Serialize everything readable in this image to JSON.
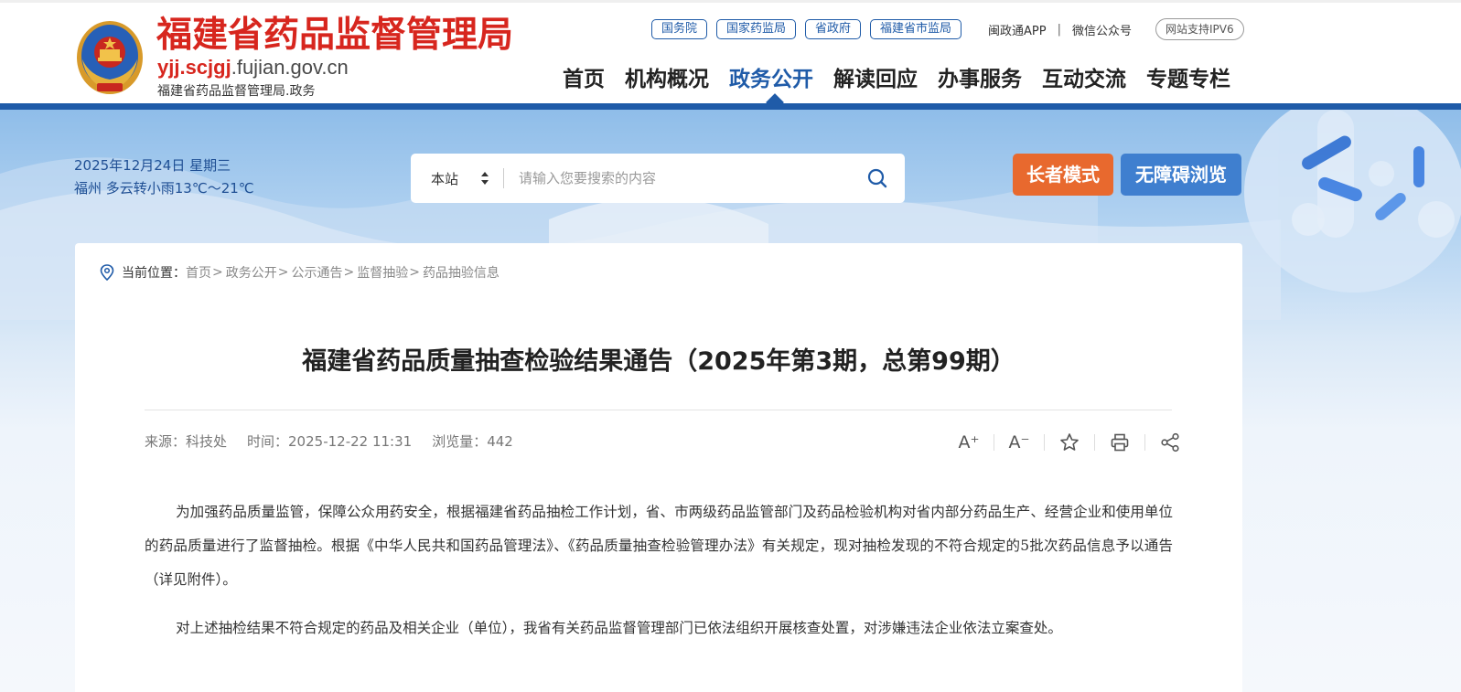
{
  "header": {
    "site_title": "福建省药品监督管理局",
    "domain_prefix": "yjj.scjgj",
    "domain_suffix": ".fujian.gov.cn",
    "site_subtitle": "福建省药品监督管理局.政务",
    "top_links": [
      "国务院",
      "国家药监局",
      "省政府",
      "福建省市监局"
    ],
    "app_link": "闽政通APP",
    "separator": "|",
    "wechat_link": "微信公众号",
    "ipv6_badge": "网站支持IPV6",
    "nav": [
      {
        "label": "首页",
        "active": false
      },
      {
        "label": "机构概况",
        "active": false
      },
      {
        "label": "政务公开",
        "active": true
      },
      {
        "label": "解读回应",
        "active": false
      },
      {
        "label": "办事服务",
        "active": false
      },
      {
        "label": "互动交流",
        "active": false
      },
      {
        "label": "专题专栏",
        "active": false
      }
    ],
    "brand_color": "#d7261e",
    "accent_color": "#1f5ba8"
  },
  "banner": {
    "date_line": "2025年12月24日 星期三",
    "weather_line": "福州 多云转小雨13℃～21℃",
    "search": {
      "scope": "本站",
      "placeholder": "请输入您要搜索的内容"
    },
    "elder_mode": "长者模式",
    "accessible": "无障碍浏览",
    "elder_color": "#e8692e",
    "accessible_color": "#3f7fcf"
  },
  "breadcrumb": {
    "label": "当前位置：",
    "items": [
      "首页",
      "政务公开",
      "公示通告",
      "监督抽验",
      "药品抽验信息"
    ],
    "separator": ">"
  },
  "article": {
    "title": "福建省药品质量抽查检验结果通告（2025年第3期，总第99期）",
    "source": "来源：科技处",
    "time": "时间：2025-12-22 11:31",
    "views": "浏览量：442",
    "tools": {
      "font_up": "A⁺",
      "font_down": "A⁻"
    },
    "paragraphs": [
      "为加强药品质量监管，保障公众用药安全，根据福建省药品抽检工作计划，省、市两级药品监管部门及药品检验机构对省内部分药品生产、经营企业和使用单位的药品质量进行了监督抽检。根据《中华人民共和国药品管理法》、《药品质量抽查检验管理办法》有关规定，现对抽检发现的不符合规定的5批次药品信息予以通告（详见附件）。",
      "对上述抽检结果不符合规定的药品及相关企业（单位），我省有关药品监督管理部门已依法组织开展核查处置，对涉嫌违法企业依法立案查处。"
    ]
  }
}
